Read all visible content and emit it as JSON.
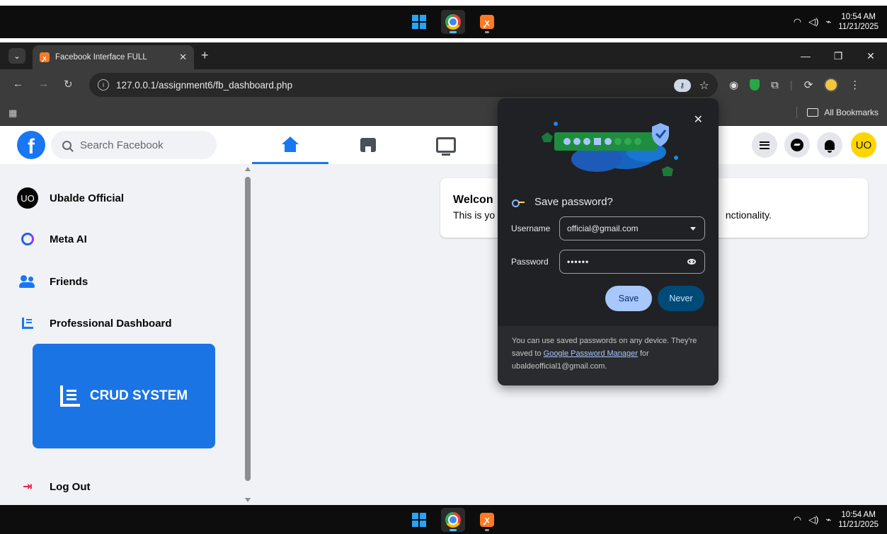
{
  "taskbar": {
    "time": "10:54 AM",
    "date": "11/21/2025"
  },
  "browser": {
    "tab_title": "Facebook Interface FULL",
    "url": "127.0.0.1/assignment6/fb_dashboard.php",
    "all_bookmarks": "All Bookmarks"
  },
  "fb": {
    "search_placeholder": "Search Facebook",
    "avatar_initials": "UO",
    "sidebar": {
      "profile_initials": "UO",
      "profile_name": "Ubalde Official",
      "meta_ai": "Meta AI",
      "friends": "Friends",
      "professional_dashboard": "Professional Dashboard",
      "crud_label": "CRUD SYSTEM",
      "logout": "Log Out"
    },
    "welcome_title": "Welcon",
    "welcome_text_left": "This is yo",
    "welcome_text_right": "nctionality."
  },
  "password_popup": {
    "title": "Save password?",
    "username_label": "Username",
    "username_value": "official@gmail.com",
    "password_label": "Password",
    "password_value": "••••••",
    "save_label": "Save",
    "never_label": "Never",
    "footer_text_1": "You can use saved passwords on any device. They're saved to ",
    "footer_link": "Google Password Manager",
    "footer_text_2": " for ubaldeofficial1@gmail.com."
  },
  "colors": {
    "facebook_blue": "#1877f2",
    "crud_card": "#1b74e4",
    "popup_bg": "#202124",
    "save_button": "#a8c7fa",
    "never_button": "#004a77",
    "avatar_yellow": "#ffd500"
  }
}
